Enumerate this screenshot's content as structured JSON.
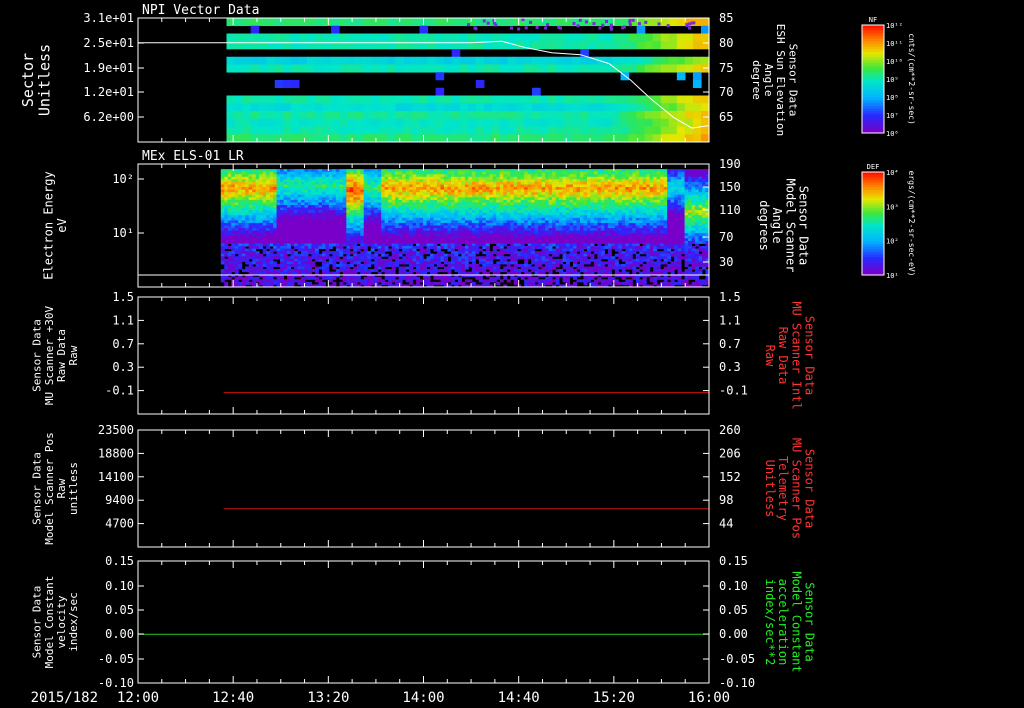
{
  "chart_data": [
    {
      "type": "heatmap",
      "title": "NPI Vector Data",
      "ylabel": "Sector\nUnitless",
      "yticks": [
        "3.1e+01",
        "2.5e+01",
        "1.9e+01",
        "1.2e+01",
        "6.2e+00"
      ],
      "yticks_right": [
        "85",
        "80",
        "75",
        "70",
        "65"
      ],
      "right_label": "Sensor Data\nESH Sun Elevation\nAngle\ndegree",
      "right_label_color": "#ffffff",
      "overlay_line": {
        "name": "ESH Sun Elevation Angle",
        "color": "#ffffff",
        "points": [
          [
            12.0,
            80.0
          ],
          [
            14.33,
            80.0
          ],
          [
            14.55,
            80.3
          ],
          [
            14.72,
            79.0
          ],
          [
            14.9,
            78.0
          ],
          [
            15.1,
            77.6
          ],
          [
            15.3,
            75.8
          ],
          [
            15.45,
            72.5
          ],
          [
            15.6,
            68.5
          ],
          [
            15.75,
            65.0
          ],
          [
            15.88,
            62.8
          ],
          [
            16.0,
            63.3
          ]
        ]
      },
      "colorbar": {
        "name": "NF",
        "unit": "cnts/(cm**2-sr-sec)",
        "ticks": [
          "10¹²",
          "10¹¹",
          "10¹⁰",
          "10⁹",
          "10⁸",
          "10⁷",
          "10⁶"
        ]
      }
    },
    {
      "type": "heatmap",
      "title": "MEx ELS-01 LR",
      "ylabel": "Electron Energy\neV",
      "yticks": [
        "10²",
        "10¹"
      ],
      "yticks_right": [
        "190",
        "150",
        "110",
        "70",
        "30"
      ],
      "right_label": "Sensor Data\nModel Scanner\nAngle\ndegrees",
      "right_label_color": "#ffffff",
      "colorbar": {
        "name": "DEF",
        "unit": "ergs/(cm**2-sr-sec-eV)",
        "ticks": [
          "10⁴",
          "10³",
          "10²",
          "10¹"
        ]
      }
    },
    {
      "type": "line",
      "ylabel": "Sensor Data\nMU Scanner +30V\nRaw Data\nRaw",
      "ylim": [
        -0.3,
        1.5
      ],
      "yticks": [
        "1.5",
        "1.1",
        "0.7",
        "0.3",
        "-0.1"
      ],
      "yticks_right": [
        "1.5",
        "1.1",
        "0.7",
        "0.3",
        "-0.1"
      ],
      "right_label": "Sensor Data\nMU Scanner Intl\nRaw Data\nRaw",
      "right_label_color": "#ff3333",
      "series": [
        {
          "color": "#cc1111",
          "x": [
            12.6,
            16.0
          ],
          "y": [
            0.03,
            0.03
          ]
        }
      ]
    },
    {
      "type": "line",
      "ylabel": "Sensor Data\nModel Scanner Pos\nRaw\nunitless",
      "ylim": [
        0,
        23500
      ],
      "yticks": [
        "23500",
        "18800",
        "14100",
        "9400",
        "4700"
      ],
      "yticks_right": [
        "260",
        "206",
        "152",
        "98",
        "44"
      ],
      "right_label": "Sensor Data\nMU Scanner Pos\nTelemetry\nUnitless",
      "right_label_color": "#ff3333",
      "series": [
        {
          "color": "#cc1111",
          "x": [
            12.6,
            16.0
          ],
          "y": [
            7700,
            7700
          ]
        }
      ]
    },
    {
      "type": "line",
      "ylabel": "Sensor Data\nModel Constant\nvelocity\nindex/sec",
      "ylim": [
        -0.1,
        0.15
      ],
      "yticks": [
        "0.15",
        "0.10",
        "0.05",
        "0.00",
        "-0.05",
        "-0.10"
      ],
      "yticks_right": [
        "0.15",
        "0.10",
        "0.05",
        "0.00",
        "-0.05",
        "-0.10"
      ],
      "right_label": "Sensor Data\nModel Constant\nacceleration\nindex/sec**2",
      "right_label_color": "#22ee22",
      "series": [
        {
          "color": "#22cc22",
          "x": [
            12.0,
            16.0
          ],
          "y": [
            0.0,
            0.0
          ]
        }
      ]
    }
  ],
  "time_axis": {
    "date": "2015/182",
    "labels": [
      "12:00",
      "12:40",
      "13:20",
      "14:00",
      "14:40",
      "15:20",
      "16:00"
    ]
  }
}
